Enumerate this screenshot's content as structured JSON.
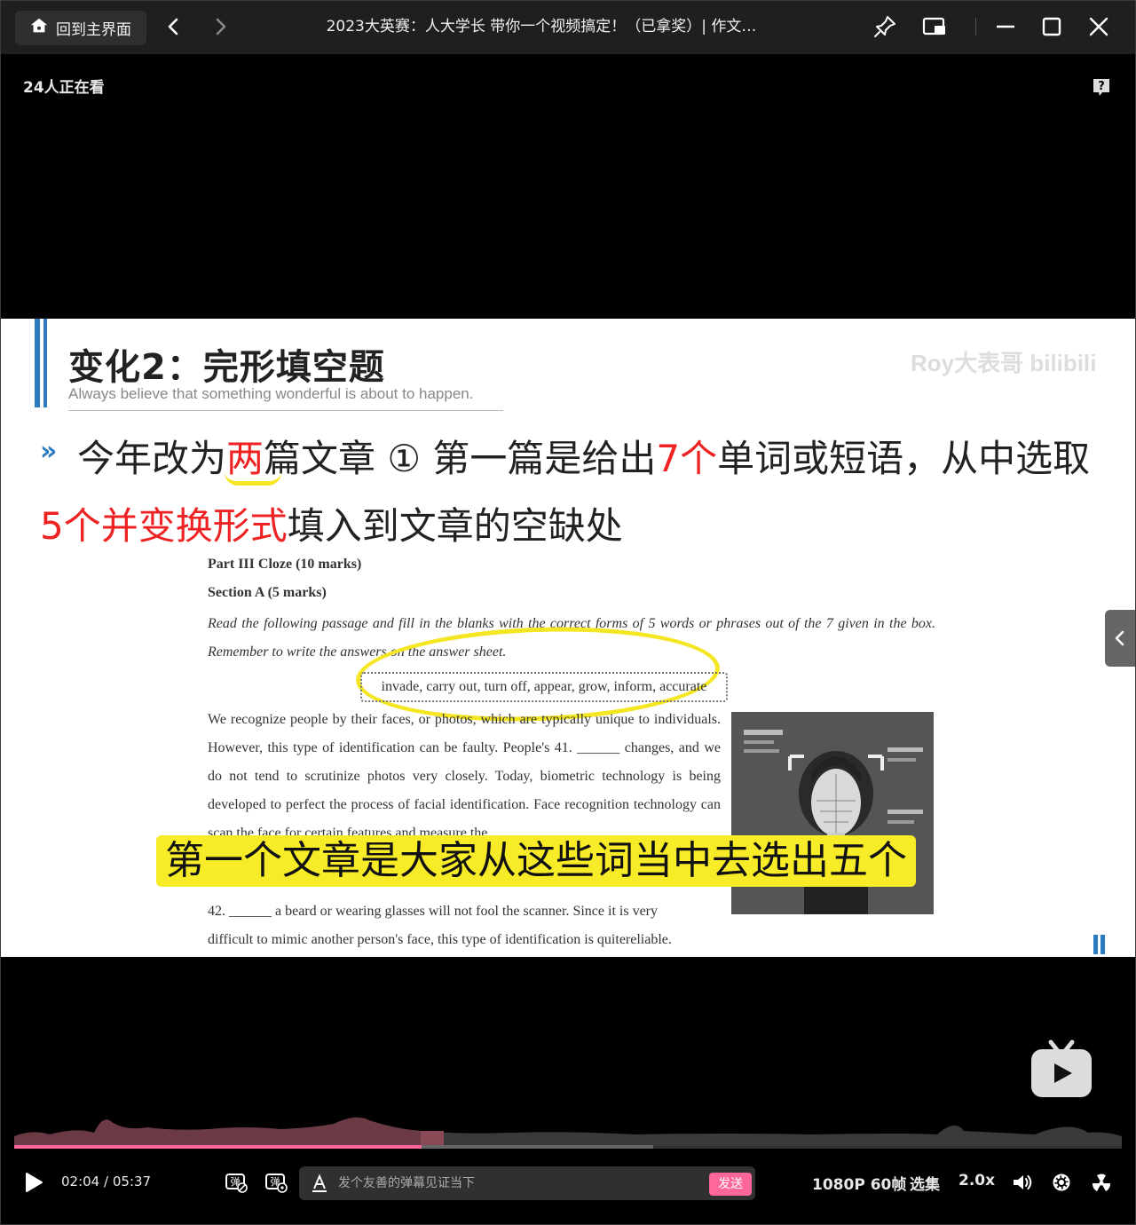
{
  "titlebar": {
    "home_label": "回到主界面",
    "title": "2023大英赛：人大学长 带你一个视频搞定！（已拿奖）| 作文…"
  },
  "video": {
    "viewers": "24人正在看"
  },
  "slide": {
    "heading_prefix": "变化2：",
    "heading_hl": "完形填空题",
    "subheading": "Always believe that something wonderful is about to happen.",
    "watermark": "Roy大表哥 bilibili",
    "bullet": "»",
    "line1_a": "今年改为",
    "line1_red1": "两",
    "line1_b": "篇文章 ① 第一篇是给出",
    "line1_red2": "7个",
    "line1_c": "单词或短语，从中选取",
    "line2_red": "5个并变换形式",
    "line2_b": "填入到文章的空缺处",
    "doc_part": "Part III Cloze (10 marks)",
    "doc_section": "Section A (5 marks)",
    "doc_instr": "Read the following passage and fill in the blanks with the correct forms of 5 words or phrases out of the 7 given in the box. Remember to write the answers on the answer sheet.",
    "word_box": "invade, carry out, turn off, appear, grow, inform, accurate",
    "passage": "We recognize people by their faces, or photos, which are typically unique to individuals. However, this type of identification can be faulty. People's 41. ______ changes, and we do not tend to scrutinize photos very closely. Today, biometric technology is being developed to perfect the process of facial identification. Face recognition technology can scan the face for certain features and measure the",
    "passage_last_a": "42. ______ a beard or wearing glasses will not fool the scanner. Since it is very",
    "passage_last_b": "difficult to mimic another person's face, this type of identification is quitereliable."
  },
  "subtitle": "第一个文章是大家从这些词当中去选出五个",
  "player": {
    "progress": 0.368,
    "current_time": "02:04",
    "separator": "/",
    "duration": "05:37",
    "danmaku_placeholder": "发个友善的弹幕见证当下",
    "send_label": "发送",
    "quality": "1080P 60帧",
    "episodes": "选集",
    "speed": "2.0x"
  },
  "colors": {
    "accent_pink": "#ff6699",
    "highlight_yellow": "#f8ec28",
    "slide_blue": "#2c7bc0",
    "red_text": "#ee2222"
  }
}
